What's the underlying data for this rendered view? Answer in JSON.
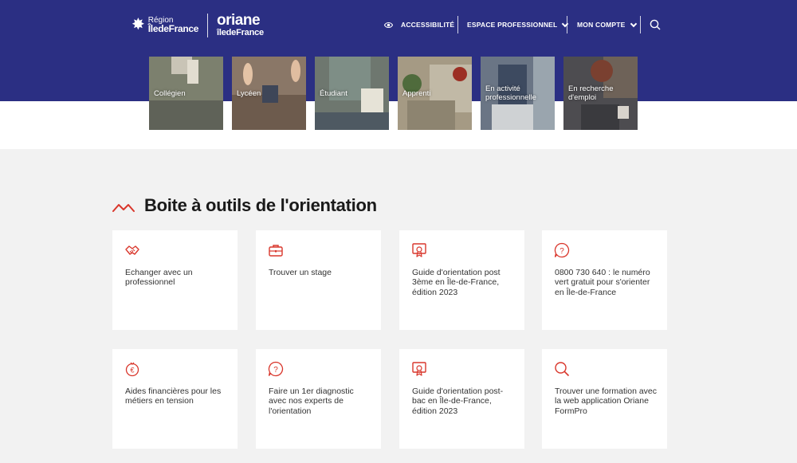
{
  "header": {
    "region_logo": {
      "line1": "Région",
      "line2": "ÎledeFrance"
    },
    "oriane_logo": {
      "line1": "oriane",
      "line2": "îledeFrance"
    },
    "nav": {
      "accessibility": "ACCESSIBILITÉ",
      "pro_space": "ESPACE PROFESSIONNEL",
      "account": "MON COMPTE"
    },
    "search_icon": "search-icon"
  },
  "audiences": [
    {
      "label": "Collégien",
      "color": "#7f8471"
    },
    {
      "label": "Lycéen",
      "color": "#8a7767"
    },
    {
      "label": "Étudiant",
      "color": "#6f7870"
    },
    {
      "label": "Apprenti",
      "color": "#9a8f76"
    },
    {
      "label": "En activité professionnelle",
      "color": "#5e6a7a"
    },
    {
      "label": "En recherche d'emploi",
      "color": "#4f4f52"
    }
  ],
  "toolbox": {
    "title": "Boite à outils de l'orientation",
    "accent": "#d9362b",
    "items": [
      {
        "label": "Echanger avec un professionnel",
        "icon": "handshake-icon"
      },
      {
        "label": "Trouver un stage",
        "icon": "briefcase-icon"
      },
      {
        "label": "Guide d'orientation post 3ème en Île-de-France, édition 2023",
        "icon": "certificate-icon"
      },
      {
        "label": "0800 730 640 : le numéro vert gratuit pour s'orienter en Île-de-France",
        "icon": "question-icon"
      },
      {
        "label": "Aides financières pour les métiers en tension",
        "icon": "euro-icon"
      },
      {
        "label": "Faire un 1er diagnostic avec nos experts de l'orientation",
        "icon": "question-icon"
      },
      {
        "label": "Guide d'orientation post-bac en Île-de-France, édition 2023",
        "icon": "certificate-icon"
      },
      {
        "label": "Trouver une formation avec la web application Oriane FormPro",
        "icon": "search-icon"
      }
    ]
  }
}
